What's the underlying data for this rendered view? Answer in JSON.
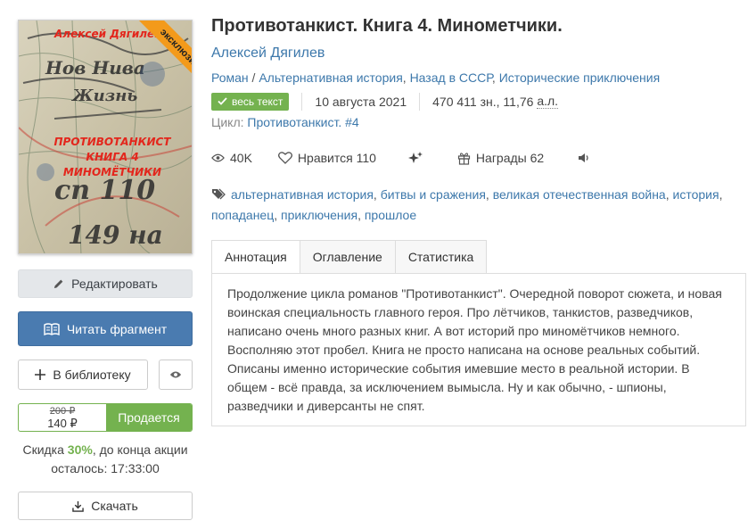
{
  "cover": {
    "author": "Алексей Дягилев",
    "title_lines": [
      "ПРОТИВОТАНКИСТ",
      "КНИГА 4",
      "МИНОМЁТЧИКИ"
    ],
    "ribbon": "эксклюзив",
    "ribbon_color": "#f39a1b"
  },
  "buttons": {
    "edit": "Редактировать",
    "read": "Читать фрагмент",
    "library": "В библиотеку",
    "sell": "Продается",
    "download": "Скачать"
  },
  "price": {
    "old": "200 ₽",
    "new": "140 ₽"
  },
  "discount": {
    "prefix": "Скидка",
    "percent": "30%",
    "suffix": ", до конца акции",
    "line2": "осталось: 17:33:00"
  },
  "book": {
    "title": "Противотанкист. Книга 4. Минометчики.",
    "author": "Алексей Дягилев",
    "genres": [
      "Роман",
      "Альтернативная история",
      "Назад в СССР",
      "Исторические приключения"
    ],
    "badge": "весь текст",
    "date": "10 августа 2021",
    "size_chars": "470 411 зн., 11,76",
    "size_unit": "а.л.",
    "cycle_label": "Цикл:",
    "cycle_name": "Противотанкист.",
    "cycle_num": "#4"
  },
  "stats": {
    "views": "40K",
    "likes_label": "Нравится",
    "likes": "110",
    "awards_label": "Награды",
    "awards": "62"
  },
  "tags": [
    "альтернативная история",
    "битвы и сражения",
    "великая отечественная война",
    "история",
    "попаданец",
    "приключения",
    "прошлое"
  ],
  "tabs": [
    "Аннотация",
    "Оглавление",
    "Статистика"
  ],
  "annotation": "Продолжение цикла романов \"Противотанкист\". Очередной поворот сюжета, и новая воинская специальность главного героя. Про лётчиков, танкистов, разведчиков, написано очень много разных книг. А вот историй про миномётчиков немного. Восполняю этот пробел. Книга не просто написана на основе реальных событий. Описаны именно исторические события имевшие место в реальной истории. В общем - всё правда, за исключением вымысла. Ну и как обычно, - шпионы, разведчики и диверсанты не спят.",
  "colors": {
    "accent_blue": "#3d78ab",
    "read_button": "#4a7bb0",
    "green": "#74b24f",
    "cover_text": "#e3261c"
  }
}
